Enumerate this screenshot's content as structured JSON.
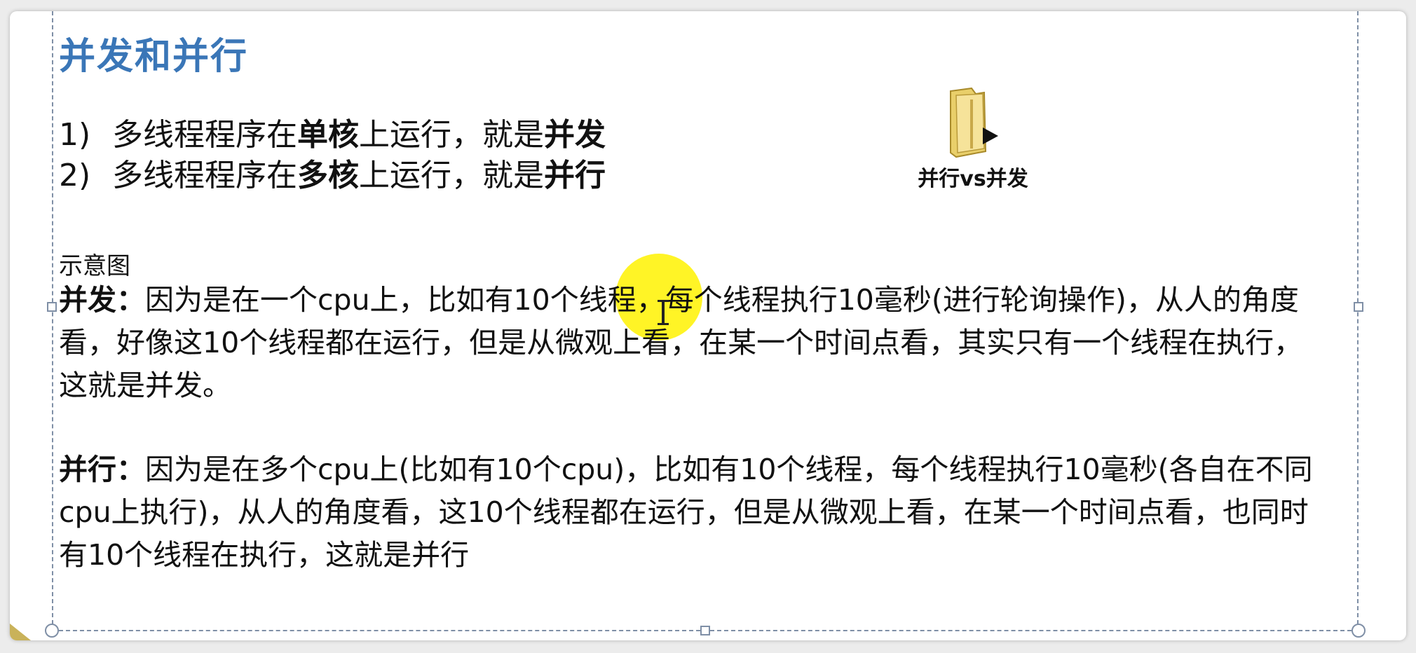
{
  "slide": {
    "title": "并发和并行",
    "list": [
      {
        "num": "1)",
        "pre": "多线程程序在",
        "bold1": "单核",
        "mid": "上运行，就是",
        "bold2": "并发"
      },
      {
        "num": "2)",
        "pre": "多线程程序在",
        "bold1": "多核",
        "mid": "上运行，就是",
        "bold2": "并行"
      }
    ],
    "caption": "示意图",
    "concurrency": {
      "head": "并发：",
      "body": "因为是在一个cpu上，比如有10个线程，每个线程执行10毫秒(进行轮询操作)，从人的角度看，好像这10个线程都在运行，但是从微观上看，在某一个时间点看，其实只有一个线程在执行，这就是并发。"
    },
    "parallelism": {
      "head": "并行：",
      "body": "因为是在多个cpu上(比如有10个cpu)，比如有10个线程，每个线程执行10毫秒(各自在不同cpu上执行)，从人的角度看，这10个线程都在运行，但是从微观上看，在某一个时间点看，也同时有10个线程在执行，这就是并行"
    },
    "file_icon": {
      "icon": "folder-file-icon",
      "label": "并行vs并发"
    }
  },
  "colors": {
    "title": "#3a76b7",
    "highlight": "#fff200",
    "selection_border": "#7f8fa6"
  }
}
